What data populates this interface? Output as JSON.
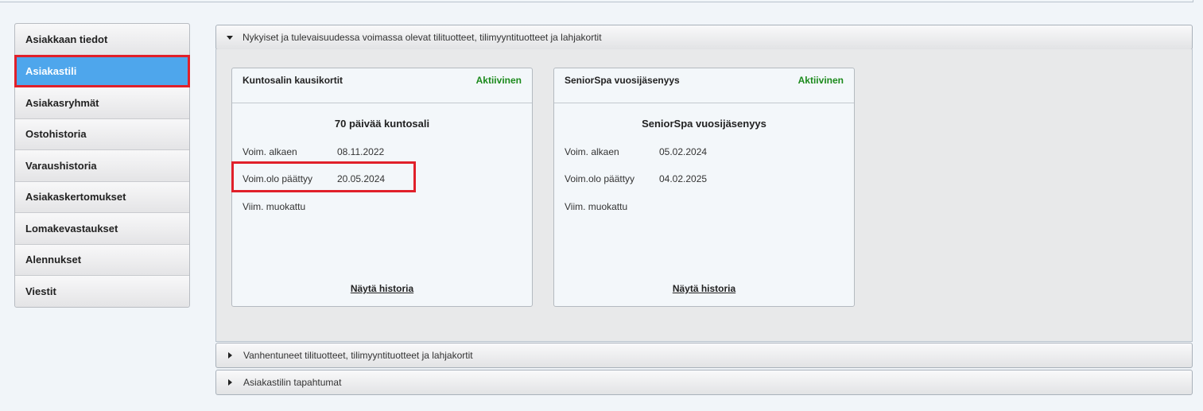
{
  "sidebar": {
    "items": [
      {
        "label": "Asiakkaan tiedot"
      },
      {
        "label": "Asiakastili"
      },
      {
        "label": "Asiakasryhmät"
      },
      {
        "label": "Ostohistoria"
      },
      {
        "label": "Varaushistoria"
      },
      {
        "label": "Asiakaskertomukset"
      },
      {
        "label": "Lomakevastaukset"
      },
      {
        "label": "Alennukset"
      },
      {
        "label": "Viestit"
      }
    ],
    "active_index": 1
  },
  "panels": {
    "current": {
      "title": "Nykyiset ja tulevaisuudessa voimassa olevat tilituotteet, tilimyyntituotteet ja lahjakortit",
      "expanded": true
    },
    "expired": {
      "title": "Vanhentuneet tilituotteet, tilimyyntituotteet ja lahjakortit",
      "expanded": false
    },
    "events": {
      "title": "Asiakastilin tapahtumat",
      "expanded": false
    }
  },
  "cards": [
    {
      "title": "Kuntosalin kausikortit",
      "status": "Aktiivinen",
      "product": "70 päivää kuntosali",
      "start_label": "Voim. alkaen",
      "start_value": "08.11.2022",
      "end_label": "Voim.olo päättyy",
      "end_value": "20.05.2024",
      "modified_label": "Viim. muokattu",
      "history_link": "Näytä historia"
    },
    {
      "title": "SeniorSpa vuosijäsenyys",
      "status": "Aktiivinen",
      "product": "SeniorSpa vuosijäsenyys",
      "start_label": "Voim. alkaen",
      "start_value": "05.02.2024",
      "end_label": "Voim.olo päättyy",
      "end_value": "04.02.2025",
      "modified_label": "Viim. muokattu",
      "history_link": "Näytä historia"
    }
  ],
  "colors": {
    "active_item": "#4ea6ec",
    "highlight": "#e0202a",
    "status_active": "#1c8a1c"
  }
}
